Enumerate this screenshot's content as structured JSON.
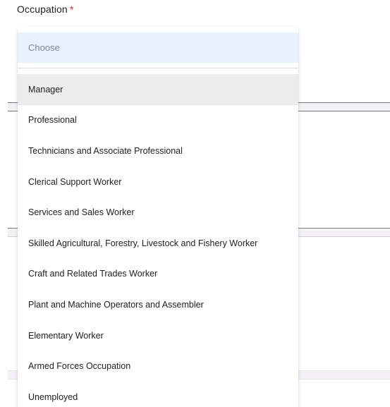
{
  "question": {
    "label": "Occupation",
    "required_marker": "*"
  },
  "dropdown": {
    "placeholder_option": "Choose",
    "hovered_option": "Manager",
    "options": [
      "Manager",
      "Professional",
      "Technicians and Associate Professional",
      "Clerical Support Worker",
      "Services and Sales Worker",
      "Skilled Agricultural, Forestry, Livestock and Fishery Worker",
      "Craft and Related Trades Worker",
      "Plant and Machine Operators and Assembler",
      "Elementary Worker",
      "Armed Forces Occupation",
      "Unemployed"
    ]
  },
  "colors": {
    "required": "#d93025",
    "selected_background": "#e8f0fe",
    "hover_background": "#ececec",
    "section_accent": "#c1575b"
  }
}
